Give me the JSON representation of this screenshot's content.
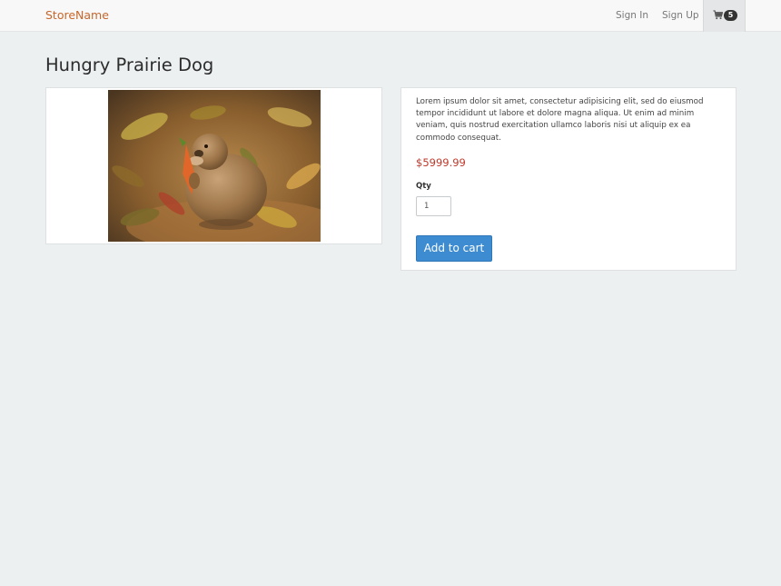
{
  "navbar": {
    "brand": "StoreName",
    "sign_in": "Sign In",
    "sign_up": "Sign Up",
    "cart_count": "5",
    "cart_icon": "shopping-cart-icon",
    "brand_color": "#c8662a"
  },
  "product": {
    "title": "Hungry Prairie Dog",
    "description": "Lorem ipsum dolor sit amet, consectetur adipisicing elit, sed do eiusmod tempor incididunt ut labore et dolore magna aliqua. Ut enim ad minim veniam, quis nostrud exercitation ullamco laboris nisi ut aliquip ex ea commodo consequat.",
    "price": "$5999.99",
    "price_color": "#c0392b",
    "qty_label": "Qty",
    "qty_value": "1",
    "add_to_cart": "Add to cart",
    "button_color": "#3d8bd0"
  }
}
